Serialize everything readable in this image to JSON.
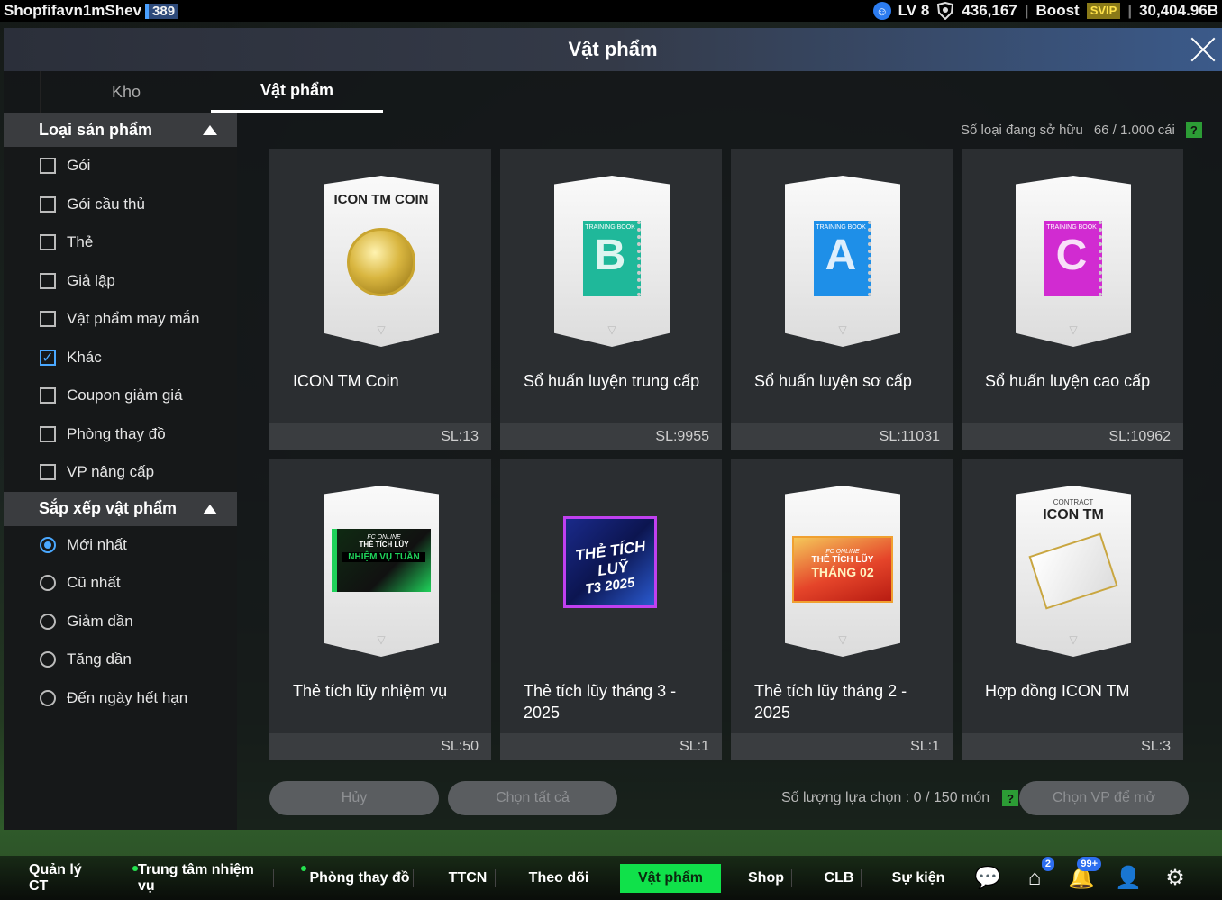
{
  "topbar": {
    "username": "Shopfifavn1mShev",
    "user_badge": "389",
    "level": "LV 8",
    "coins": "436,167",
    "boost_label": "Boost",
    "svip_label": "SVIP",
    "balance": "30,404.96B"
  },
  "window": {
    "title": "Vật phẩm"
  },
  "tabs": [
    {
      "label": "Kho"
    },
    {
      "label": "Vật phẩm"
    }
  ],
  "sidebar": {
    "category": {
      "header": "Loại sản phẩm",
      "options": [
        {
          "label": "Gói",
          "checked": false
        },
        {
          "label": "Gói cầu thủ",
          "checked": false
        },
        {
          "label": "Thẻ",
          "checked": false
        },
        {
          "label": "Giả lập",
          "checked": false
        },
        {
          "label": "Vật phẩm may mắn",
          "checked": false
        },
        {
          "label": "Khác",
          "checked": true
        },
        {
          "label": "Coupon giảm giá",
          "checked": false
        },
        {
          "label": "Phòng thay đồ",
          "checked": false
        },
        {
          "label": "VP nâng cấp",
          "checked": false
        }
      ]
    },
    "sort": {
      "header": "Sắp xếp vật phẩm",
      "options": [
        {
          "label": "Mới nhất",
          "selected": true
        },
        {
          "label": "Cũ nhất",
          "selected": false
        },
        {
          "label": "Giảm dần",
          "selected": false
        },
        {
          "label": "Tăng dần",
          "selected": false
        },
        {
          "label": "Đến ngày hết hạn",
          "selected": false
        }
      ]
    }
  },
  "owned": {
    "label": "Số loại đang sở hữu",
    "value": "66 / 1.000 cái",
    "help": "?"
  },
  "items": [
    {
      "name": "ICON TM Coin",
      "qty": "SL:13",
      "art_label": "ICON TM COIN",
      "art": "coin"
    },
    {
      "name": "Sổ huấn luyện trung cấp",
      "qty": "SL:9955",
      "art_label": "B",
      "art": "book",
      "color": "#1fb89a"
    },
    {
      "name": "Sổ huấn luyện sơ cấp",
      "qty": "SL:11031",
      "art_label": "A",
      "art": "book",
      "color": "#1e8fe8"
    },
    {
      "name": "Sổ huấn luyện cao cấp",
      "qty": "SL:10962",
      "art_label": "C",
      "art": "book",
      "color": "#d12bd1"
    },
    {
      "name": "Thẻ tích lũy nhiệm vụ",
      "qty": "SL:50",
      "art_label": "NHIỆM VỤ TUẦN",
      "art_sub": "THẺ TÍCH LŨY",
      "art": "mission"
    },
    {
      "name": "Thẻ tích lũy tháng 3 - 2025",
      "qty": "SL:1",
      "art_label": "THẺ TÍCH LUỸ",
      "art_sub": "T3 2025",
      "art": "t3"
    },
    {
      "name": "Thẻ tích lũy tháng 2 - 2025",
      "qty": "SL:1",
      "art_label": "THÁNG 02",
      "art_sub": "THẺ TÍCH LŨY",
      "art": "t2"
    },
    {
      "name": "Hợp đồng ICON TM",
      "qty": "SL:3",
      "art_label": "ICON TM",
      "art_sub": "CONTRACT",
      "art": "contract"
    }
  ],
  "book_tag": "TRAINING BOOK",
  "brand_tag": "FC ONLINE",
  "actions": {
    "cancel": "Hủy",
    "select_all": "Chọn tất cả",
    "selection_label": "Số lượng lựa chọn : 0 / 150 món",
    "help": "?",
    "open": "Chọn VP để mở"
  },
  "bottomnav": [
    {
      "label": "Quản lý CT",
      "dot": false,
      "active": false
    },
    {
      "label": "Trung tâm nhiệm vụ",
      "dot": true,
      "active": false
    },
    {
      "label": "Phòng thay đồ",
      "dot": true,
      "active": false
    },
    {
      "label": "TTCN",
      "dot": false,
      "active": false
    },
    {
      "label": "Theo dõi",
      "dot": false,
      "active": false
    },
    {
      "label": "Vật phẩm",
      "dot": false,
      "active": true
    },
    {
      "label": "Shop",
      "dot": false,
      "active": false
    },
    {
      "label": "CLB",
      "dot": false,
      "active": false
    },
    {
      "label": "Sự kiện",
      "dot": false,
      "active": false
    }
  ],
  "nav_badges": {
    "home": "2",
    "notifications": "99+"
  },
  "colors": {
    "accent": "#4aa8ff",
    "active_nav": "#10e14a",
    "help_green": "#2c9c35"
  }
}
